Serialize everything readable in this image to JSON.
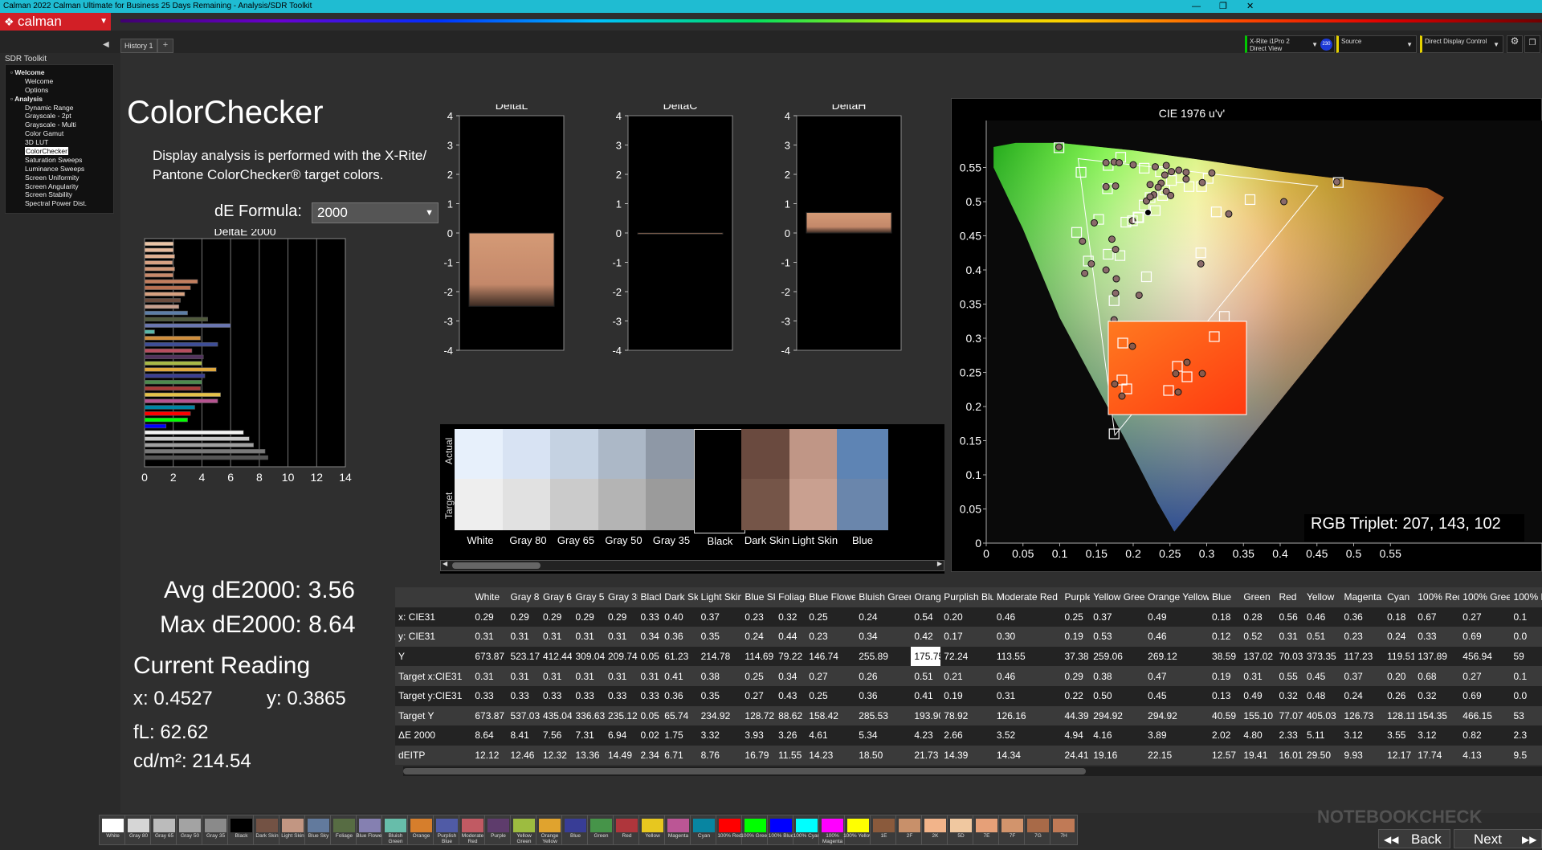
{
  "window": {
    "title": "Calman 2022 Calman Ultimate for Business 25 Days Remaining  - Analysis/SDR Toolkit",
    "controls": [
      "—",
      "❐",
      "✕"
    ]
  },
  "logo": {
    "text": "calman"
  },
  "tabs": {
    "history": "History 1",
    "add": "+"
  },
  "devices": [
    {
      "line1": "X-Rite i1Pro 2",
      "line2": "Direct View",
      "badge": "230"
    },
    {
      "line1": "Source",
      "line2": ""
    },
    {
      "line1": "Direct Display Control",
      "line2": ""
    }
  ],
  "sidebar": {
    "title": "SDR Toolkit",
    "items": [
      {
        "label": "Welcome",
        "level": 0
      },
      {
        "label": "Welcome",
        "level": 1
      },
      {
        "label": "Options",
        "level": 1
      },
      {
        "label": "Analysis",
        "level": 0
      },
      {
        "label": "Dynamic Range",
        "level": 1
      },
      {
        "label": "Grayscale - 2pt",
        "level": 1
      },
      {
        "label": "Grayscale - Multi",
        "level": 1
      },
      {
        "label": "Color Gamut",
        "level": 1
      },
      {
        "label": "3D LUT",
        "level": 1
      },
      {
        "label": "ColorChecker",
        "level": 1,
        "selected": true
      },
      {
        "label": "Saturation Sweeps",
        "level": 1
      },
      {
        "label": "Luminance Sweeps",
        "level": 1
      },
      {
        "label": "Screen Uniformity",
        "level": 1
      },
      {
        "label": "Screen Angularity",
        "level": 1
      },
      {
        "label": "Screen Stability",
        "level": 1
      },
      {
        "label": "Spectral Power Dist.",
        "level": 1
      }
    ]
  },
  "page": {
    "title": "ColorChecker",
    "description": "Display analysis is performed with the X-Rite/ Pantone ColorChecker® target colors.",
    "de_formula_label": "dE Formula:",
    "de_formula_value": "2000",
    "avg": "Avg dE2000: 3.56",
    "max": "Max dE2000: 8.64",
    "current_reading": "Current Reading",
    "x": "x: 0.4527",
    "y": "y: 0.3865",
    "fl": "fL: 62.62",
    "cdm2": "cd/m²: 214.54",
    "rgb_triplet": "RGB Triplet: 207, 143, 102"
  },
  "chart_data": [
    {
      "type": "bar",
      "title": "DeltaE 2000",
      "orientation": "horizontal",
      "xlim": [
        0,
        14
      ],
      "xticks": [
        "0",
        "2",
        "4",
        "6",
        "8",
        "10",
        "12",
        "14"
      ],
      "values": [
        2.02,
        2.02,
        2.1,
        1.95,
        2.1,
        2.0,
        3.7,
        3.2,
        2.8,
        2.5,
        2.4,
        3.0,
        4.4,
        6.0,
        0.7,
        3.9,
        5.1,
        3.3,
        4.1,
        4.0,
        5.0,
        4.2,
        4.0,
        3.9,
        5.3,
        5.1,
        3.5,
        3.2,
        3.0,
        1.5,
        6.9,
        7.3,
        7.6,
        8.4,
        8.6
      ],
      "colors": [
        "#e9c4a6",
        "#e5b99c",
        "#dfae90",
        "#d8a283",
        "#d19676",
        "#c98a6a",
        "#c27e5e",
        "#b97152",
        "#d6a180",
        "#6b4c3e",
        "#c7a08e",
        "#5d7ea7",
        "#505a3d",
        "#6a76b1",
        "#5bb7a8",
        "#cf8e3e",
        "#3e4e98",
        "#b84e5f",
        "#52335d",
        "#a8b947",
        "#dfa83e",
        "#3b3f92",
        "#4d8a4e",
        "#aa3b39",
        "#e6c34a",
        "#b65490",
        "#0085a4",
        "#ff0000",
        "#00ff00",
        "#0000ff",
        "#f3f3f2",
        "#c8c8c8",
        "#a0a0a0",
        "#7a7a7a",
        "#555555"
      ]
    },
    {
      "type": "bar",
      "title": "DeltaL",
      "ylim": [
        -4,
        4
      ],
      "yticks": [
        "4",
        "3",
        "2",
        "1",
        "0",
        "-1",
        "-2",
        "-3",
        "-4"
      ],
      "values": [
        -2.5
      ]
    },
    {
      "type": "bar",
      "title": "DeltaC",
      "ylim": [
        -4,
        4
      ],
      "yticks": [
        "4",
        "3",
        "2",
        "1",
        "0",
        "-1",
        "-2",
        "-3",
        "-4"
      ],
      "values": [
        -0.03
      ]
    },
    {
      "type": "bar",
      "title": "DeltaH",
      "ylim": [
        -4,
        4
      ],
      "yticks": [
        "4",
        "3",
        "2",
        "1",
        "0",
        "-1",
        "-2",
        "-3",
        "-4"
      ],
      "values": [
        0.7
      ]
    },
    {
      "type": "scatter",
      "title": "CIE 1976 u'v'",
      "xlim": [
        0,
        0.6
      ],
      "ylim": [
        0,
        0.6
      ],
      "xticks": [
        "0",
        "0.05",
        "0.1",
        "0.15",
        "0.2",
        "0.25",
        "0.3",
        "0.35",
        "0.4",
        "0.45",
        "0.5",
        "0.55"
      ],
      "yticks": [
        "0",
        "0.05",
        "0.1",
        "0.15",
        "0.2",
        "0.25",
        "0.3",
        "0.35",
        "0.4",
        "0.45",
        "0.5",
        "0.55"
      ],
      "gamut_triangle": [
        [
          0.451,
          0.523
        ],
        [
          0.125,
          0.563
        ],
        [
          0.175,
          0.158
        ]
      ],
      "targets": [
        [
          0.099,
          0.579
        ],
        [
          0.183,
          0.565
        ],
        [
          0.166,
          0.553
        ],
        [
          0.129,
          0.543
        ],
        [
          0.165,
          0.519
        ],
        [
          0.215,
          0.549
        ],
        [
          0.237,
          0.544
        ],
        [
          0.252,
          0.531
        ],
        [
          0.265,
          0.535
        ],
        [
          0.302,
          0.534
        ],
        [
          0.293,
          0.522
        ],
        [
          0.243,
          0.517
        ],
        [
          0.223,
          0.506
        ],
        [
          0.24,
          0.509
        ],
        [
          0.276,
          0.522
        ],
        [
          0.215,
          0.495
        ],
        [
          0.23,
          0.487
        ],
        [
          0.313,
          0.485
        ],
        [
          0.359,
          0.503
        ],
        [
          0.479,
          0.528
        ],
        [
          0.153,
          0.474
        ],
        [
          0.199,
          0.472
        ],
        [
          0.19,
          0.47
        ],
        [
          0.123,
          0.455
        ],
        [
          0.139,
          0.413
        ],
        [
          0.182,
          0.421
        ],
        [
          0.166,
          0.423
        ],
        [
          0.292,
          0.425
        ],
        [
          0.218,
          0.39
        ],
        [
          0.174,
          0.355
        ],
        [
          0.324,
          0.332
        ],
        [
          0.177,
          0.287
        ],
        [
          0.174,
          0.16
        ]
      ],
      "measured": [
        [
          0.099,
          0.58
        ],
        [
          0.174,
          0.558
        ],
        [
          0.163,
          0.557
        ],
        [
          0.181,
          0.557
        ],
        [
          0.2,
          0.554
        ],
        [
          0.245,
          0.553
        ],
        [
          0.23,
          0.551
        ],
        [
          0.262,
          0.546
        ],
        [
          0.252,
          0.544
        ],
        [
          0.243,
          0.539
        ],
        [
          0.272,
          0.543
        ],
        [
          0.307,
          0.542
        ],
        [
          0.223,
          0.525
        ],
        [
          0.238,
          0.527
        ],
        [
          0.294,
          0.528
        ],
        [
          0.272,
          0.533
        ],
        [
          0.163,
          0.522
        ],
        [
          0.176,
          0.523
        ],
        [
          0.234,
          0.521
        ],
        [
          0.245,
          0.515
        ],
        [
          0.251,
          0.509
        ],
        [
          0.228,
          0.51
        ],
        [
          0.218,
          0.501
        ],
        [
          0.223,
          0.507
        ],
        [
          0.33,
          0.482
        ],
        [
          0.405,
          0.5
        ],
        [
          0.477,
          0.529
        ],
        [
          0.199,
          0.472
        ],
        [
          0.147,
          0.469
        ],
        [
          0.131,
          0.442
        ],
        [
          0.171,
          0.445
        ],
        [
          0.176,
          0.43
        ],
        [
          0.143,
          0.409
        ],
        [
          0.134,
          0.395
        ],
        [
          0.163,
          0.4
        ],
        [
          0.177,
          0.387
        ],
        [
          0.292,
          0.409
        ],
        [
          0.208,
          0.363
        ],
        [
          0.176,
          0.366
        ],
        [
          0.174,
          0.327
        ],
        [
          0.178,
          0.303
        ],
        [
          0.307,
          0.31
        ],
        [
          0.175,
          0.262
        ]
      ],
      "current": [
        0.207,
        0.477
      ],
      "inset_targets": [
        [
          1398,
          427
        ],
        [
          1512,
          419
        ],
        [
          1466,
          456
        ],
        [
          1397,
          473
        ],
        [
          1478,
          469
        ],
        [
          1403,
          484
        ],
        [
          1455,
          486
        ]
      ],
      "inset_measured": [
        [
          1410,
          431
        ],
        [
          1478,
          451
        ],
        [
          1464,
          465
        ],
        [
          1388,
          478
        ],
        [
          1497,
          465
        ],
        [
          1397,
          493
        ],
        [
          1467,
          488
        ]
      ]
    }
  ],
  "patch_panel": {
    "row_labels": [
      "Actual",
      "Target"
    ],
    "patches": [
      {
        "label": "White",
        "actual": "#e7f0fb",
        "target": "#eeeeee"
      },
      {
        "label": "Gray 80",
        "actual": "#d8e3f3",
        "target": "#e1e1e1"
      },
      {
        "label": "Gray 65",
        "actual": "#c5d2e2",
        "target": "#cbcbcb"
      },
      {
        "label": "Gray 50",
        "actual": "#acb8c7",
        "target": "#b4b4b4"
      },
      {
        "label": "Gray 35",
        "actual": "#8e98a6",
        "target": "#9b9b9b"
      },
      {
        "label": "Black",
        "actual": "#000000",
        "target": "#000000"
      },
      {
        "label": "Dark Skin",
        "actual": "#6a4a3f",
        "target": "#755548"
      },
      {
        "label": "Light Skin",
        "actual": "#c09686",
        "target": "#c9a090"
      },
      {
        "label": "Blue",
        "actual": "#5e84b4",
        "target": "#6a86ac"
      }
    ]
  },
  "table": {
    "columns": [
      "White",
      "Gray 80",
      "Gray 65",
      "Gray 50",
      "Gray 35",
      "Black",
      "Dark Skin",
      "Light Skin",
      "Blue Sky",
      "Foliage",
      "Blue Flower",
      "Bluish Green",
      "Orange",
      "Purplish Blue",
      "Moderate Red",
      "Purple",
      "Yellow Green",
      "Orange Yellow",
      "Blue",
      "Green",
      "Red",
      "Yellow",
      "Magenta",
      "Cyan",
      "100% Red",
      "100% Green",
      "100% B"
    ],
    "rows": [
      {
        "label": "x: CIE31",
        "cells": [
          "0.29",
          "0.29",
          "0.29",
          "0.29",
          "0.29",
          "0.33",
          "0.40",
          "0.37",
          "0.23",
          "0.32",
          "0.25",
          "0.24",
          "0.54",
          "0.20",
          "0.46",
          "0.25",
          "0.37",
          "0.49",
          "0.18",
          "0.28",
          "0.56",
          "0.46",
          "0.36",
          "0.18",
          "0.67",
          "0.27",
          "0.1"
        ]
      },
      {
        "label": "y: CIE31",
        "cells": [
          "0.31",
          "0.31",
          "0.31",
          "0.31",
          "0.31",
          "0.34",
          "0.36",
          "0.35",
          "0.24",
          "0.44",
          "0.23",
          "0.34",
          "0.42",
          "0.17",
          "0.30",
          "0.19",
          "0.53",
          "0.46",
          "0.12",
          "0.52",
          "0.31",
          "0.51",
          "0.23",
          "0.24",
          "0.33",
          "0.69",
          "0.0"
        ]
      },
      {
        "label": "Y",
        "cells": [
          "673.87",
          "523.17",
          "412.44",
          "309.04",
          "209.74",
          "0.05",
          "61.23",
          "214.78",
          "114.69",
          "79.22",
          "146.74",
          "255.89",
          "175.75",
          "72.24",
          "113.55",
          "37.38",
          "259.06",
          "269.12",
          "38.59",
          "137.02",
          "70.03",
          "373.35",
          "117.23",
          "119.51",
          "137.89",
          "456.94",
          "59"
        ]
      },
      {
        "label": "Target x:CIE31",
        "cells": [
          "0.31",
          "0.31",
          "0.31",
          "0.31",
          "0.31",
          "0.31",
          "0.41",
          "0.38",
          "0.25",
          "0.34",
          "0.27",
          "0.26",
          "0.51",
          "0.21",
          "0.46",
          "0.29",
          "0.38",
          "0.47",
          "0.19",
          "0.31",
          "0.55",
          "0.45",
          "0.37",
          "0.20",
          "0.68",
          "0.27",
          "0.1"
        ]
      },
      {
        "label": "Target y:CIE31",
        "cells": [
          "0.33",
          "0.33",
          "0.33",
          "0.33",
          "0.33",
          "0.33",
          "0.36",
          "0.35",
          "0.27",
          "0.43",
          "0.25",
          "0.36",
          "0.41",
          "0.19",
          "0.31",
          "0.22",
          "0.50",
          "0.45",
          "0.13",
          "0.49",
          "0.32",
          "0.48",
          "0.24",
          "0.26",
          "0.32",
          "0.69",
          "0.0"
        ]
      },
      {
        "label": "Target Y",
        "cells": [
          "673.87",
          "537.03",
          "435.04",
          "336.63",
          "235.12",
          "0.05",
          "65.74",
          "234.92",
          "128.72",
          "88.62",
          "158.42",
          "285.53",
          "193.90",
          "78.92",
          "126.16",
          "44.39",
          "294.92",
          "294.92",
          "40.59",
          "155.10",
          "77.07",
          "405.03",
          "126.73",
          "128.11",
          "154.35",
          "466.15",
          "53"
        ]
      },
      {
        "label": "ΔE 2000",
        "cells": [
          "8.64",
          "8.41",
          "7.56",
          "7.31",
          "6.94",
          "0.02",
          "1.75",
          "3.32",
          "3.93",
          "3.26",
          "4.61",
          "5.34",
          "4.23",
          "2.66",
          "3.52",
          "4.94",
          "4.16",
          "3.89",
          "2.02",
          "4.80",
          "2.33",
          "5.11",
          "3.12",
          "3.55",
          "3.12",
          "0.82",
          "2.3"
        ]
      },
      {
        "label": "dEITP",
        "cells": [
          "12.12",
          "12.46",
          "12.32",
          "13.36",
          "14.49",
          "2.34",
          "6.71",
          "8.76",
          "16.79",
          "11.55",
          "14.23",
          "18.50",
          "21.73",
          "14.39",
          "14.34",
          "24.41",
          "19.16",
          "22.15",
          "12.57",
          "19.41",
          "16.01",
          "29.50",
          "9.93",
          "12.17",
          "17.74",
          "4.13",
          "9.5"
        ]
      }
    ]
  },
  "bottom_swatches": [
    {
      "label": "White",
      "color": "#ffffff"
    },
    {
      "label": "Gray 80",
      "color": "#d6d6d6"
    },
    {
      "label": "Gray 65",
      "color": "#bbbbbb"
    },
    {
      "label": "Gray 50",
      "color": "#a3a3a3"
    },
    {
      "label": "Gray 35",
      "color": "#8a8a8a"
    },
    {
      "label": "Black",
      "color": "#000000"
    },
    {
      "label": "Dark Skin",
      "color": "#735244"
    },
    {
      "label": "Light Skin",
      "color": "#c29682"
    },
    {
      "label": "Blue Sky",
      "color": "#627a9d"
    },
    {
      "label": "Foliage",
      "color": "#576c43"
    },
    {
      "label": "Blue Flower",
      "color": "#8580b1"
    },
    {
      "label": "Bluish Green",
      "color": "#67bdaa"
    },
    {
      "label": "Orange",
      "color": "#d67e2c"
    },
    {
      "label": "Purplish Blue",
      "color": "#505ba6"
    },
    {
      "label": "Moderate Red",
      "color": "#c15a63"
    },
    {
      "label": "Purple",
      "color": "#5e3c6c"
    },
    {
      "label": "Yellow Green",
      "color": "#9dbc40"
    },
    {
      "label": "Orange Yellow",
      "color": "#e0a32e"
    },
    {
      "label": "Blue",
      "color": "#383d96"
    },
    {
      "label": "Green",
      "color": "#469449"
    },
    {
      "label": "Red",
      "color": "#af363c"
    },
    {
      "label": "Yellow",
      "color": "#e7c71f"
    },
    {
      "label": "Magenta",
      "color": "#bb5695"
    },
    {
      "label": "Cyan",
      "color": "#0885a1"
    },
    {
      "label": "100% Red",
      "color": "#ff0000"
    },
    {
      "label": "100% Green",
      "color": "#00ff00"
    },
    {
      "label": "100% Blue",
      "color": "#0000ff"
    },
    {
      "label": "100% Cyan",
      "color": "#00ffff"
    },
    {
      "label": "100% Magenta",
      "color": "#ff00ff"
    },
    {
      "label": "100% Yellow",
      "color": "#ffff00"
    },
    {
      "label": "1E",
      "color": "#8a5a3c"
    },
    {
      "label": "2F",
      "color": "#c8906a"
    },
    {
      "label": "2K",
      "color": "#f2b48a"
    },
    {
      "label": "5D",
      "color": "#f0c8a0"
    },
    {
      "label": "7E",
      "color": "#e6a078"
    },
    {
      "label": "7F",
      "color": "#d2946c"
    },
    {
      "label": "7G",
      "color": "#a86a48"
    },
    {
      "label": "7H",
      "color": "#c07a56"
    }
  ],
  "nav": {
    "back": "Back",
    "next": "Next"
  },
  "watermark": "NOTEBOOKCHECK"
}
